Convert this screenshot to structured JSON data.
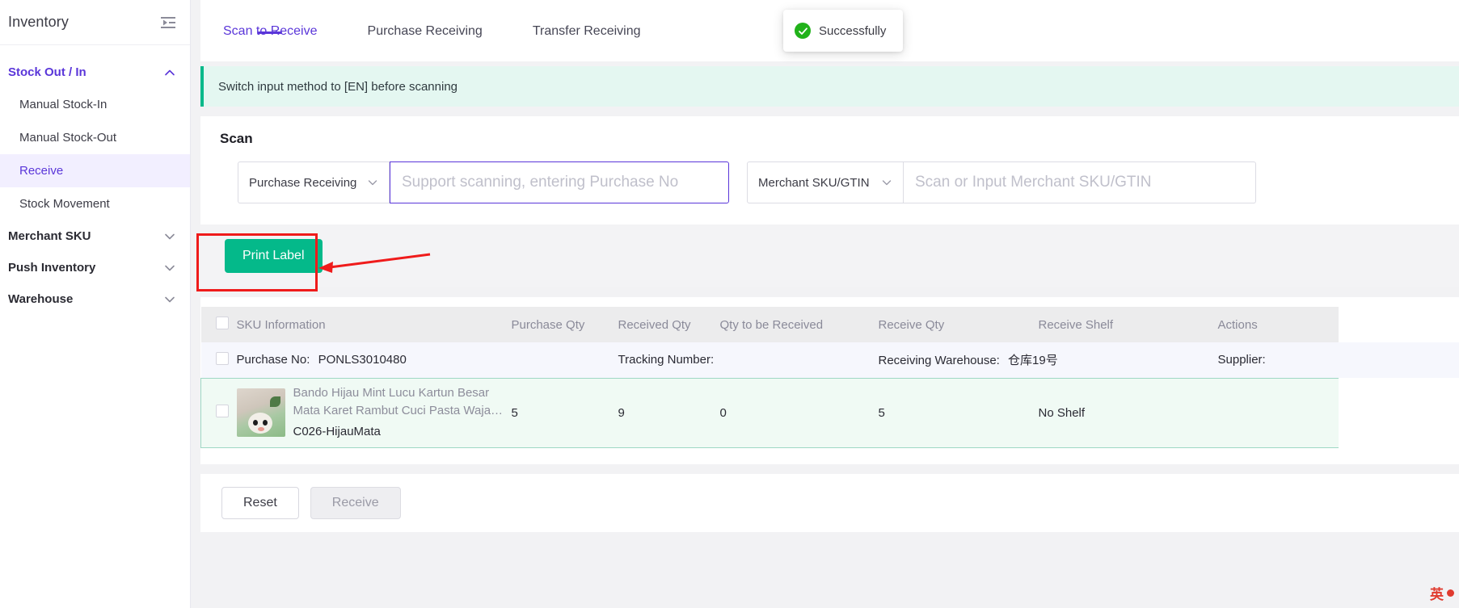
{
  "sidebar": {
    "title": "Inventory",
    "fold_icon": "menu-fold-icon",
    "groups": [
      {
        "label": "Stock Out / In",
        "state": "expanded",
        "chevron": "chevron-up-icon",
        "items": [
          {
            "label": "Manual Stock-In",
            "selected": false
          },
          {
            "label": "Manual Stock-Out",
            "selected": false
          },
          {
            "label": "Receive",
            "selected": true
          },
          {
            "label": "Stock Movement",
            "selected": false
          }
        ]
      },
      {
        "label": "Merchant SKU",
        "state": "collapsed",
        "chevron": "chevron-down-icon",
        "items": []
      },
      {
        "label": "Push Inventory",
        "state": "collapsed",
        "chevron": "chevron-down-icon",
        "items": []
      },
      {
        "label": "Warehouse",
        "state": "collapsed",
        "chevron": "chevron-down-icon",
        "items": []
      }
    ]
  },
  "tabs": [
    {
      "label": "Scan to Receive",
      "active": true
    },
    {
      "label": "Purchase Receiving",
      "active": false
    },
    {
      "label": "Transfer Receiving",
      "active": false
    }
  ],
  "toast": {
    "icon": "success-check-icon",
    "message": "Successfully"
  },
  "banner": {
    "text": "Switch input method to [EN] before scanning"
  },
  "scan": {
    "title": "Scan",
    "type_select": {
      "value": "Purchase Receiving",
      "icon": "chevron-down-icon"
    },
    "scan_input": {
      "value": "",
      "placeholder": "Support scanning, entering Purchase No"
    },
    "sku_select": {
      "value": "Merchant SKU/GTIN",
      "icon": "chevron-down-icon"
    },
    "sku_input": {
      "value": "",
      "placeholder": "Scan or Input Merchant SKU/GTIN"
    }
  },
  "actions": {
    "print_label": "Print Label",
    "reset": "Reset",
    "receive": "Receive"
  },
  "table": {
    "columns": [
      "SKU Information",
      "Purchase Qty",
      "Received Qty",
      "Qty to be Received",
      "Receive Qty",
      "Receive Shelf",
      "Actions"
    ],
    "group_row": {
      "purchase_no_label": "Purchase No:",
      "purchase_no_value": "PONLS3010480",
      "tracking_label": "Tracking Number:",
      "tracking_value": "",
      "warehouse_label": "Receiving Warehouse:",
      "warehouse_value": "仓库19号",
      "supplier_label": "Supplier:",
      "supplier_value": ""
    },
    "rows": [
      {
        "image": "product-thumbnail",
        "name": "Bando Hijau Mint Lucu Kartun Besar Mata Karet Rambut Cuci Pasta Waja…",
        "sku_code": "C026-HijauMata",
        "purchase_qty": "5",
        "received_qty": "9",
        "qty_to_be_received": "0",
        "receive_qty": "5",
        "receive_shelf": "No Shelf",
        "actions": ""
      }
    ]
  },
  "annotation": {
    "highlight_color": "#ef1b1b",
    "target": "print-label-button"
  },
  "ime": {
    "label": "英"
  },
  "colors": {
    "accent": "#5a36d9",
    "success": "#04b98a",
    "banner_bg": "#e4f7f1",
    "selected_row": "#f0faf4"
  }
}
